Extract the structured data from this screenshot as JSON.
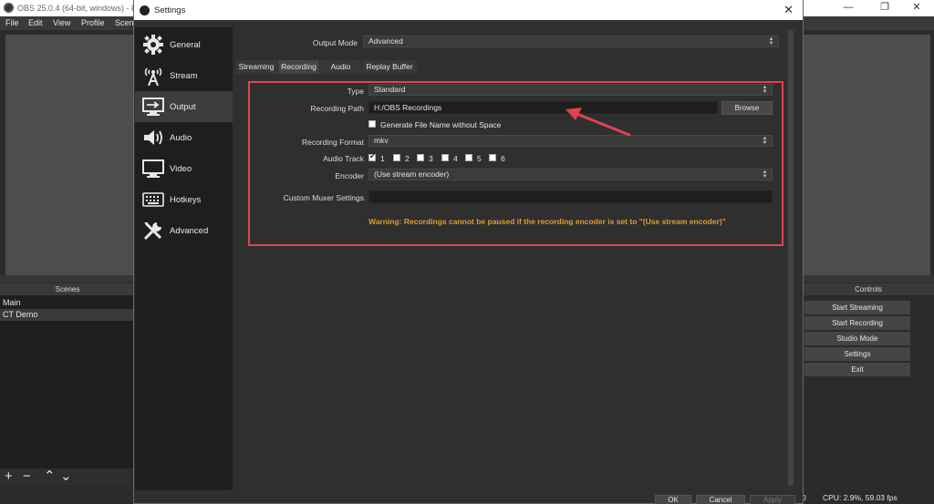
{
  "obs_window": {
    "title": "OBS 25.0.4 (64-bit, windows) - P",
    "menu": [
      "File",
      "Edit",
      "View",
      "Profile",
      "Scen"
    ],
    "scenes": {
      "header": "Scenes",
      "items": [
        "Main",
        "CT Demo"
      ],
      "selected": "CT Demo",
      "toolbar": [
        "+",
        "−",
        "⌃",
        "⌄"
      ]
    },
    "controls": {
      "header": "Controls",
      "buttons": [
        "Start Streaming",
        "Start Recording",
        "Studio Mode",
        "Settings",
        "Exit"
      ]
    },
    "status": {
      "zero": "0",
      "cpu": "CPU: 2.9%, 59.03 fps"
    }
  },
  "settings": {
    "title": "Settings",
    "nav": [
      {
        "label": "General",
        "icon": "gear-icon"
      },
      {
        "label": "Stream",
        "icon": "antenna-icon"
      },
      {
        "label": "Output",
        "icon": "monitor-arrow-icon",
        "active": true
      },
      {
        "label": "Audio",
        "icon": "speaker-icon"
      },
      {
        "label": "Video",
        "icon": "monitor-icon"
      },
      {
        "label": "Hotkeys",
        "icon": "keyboard-icon"
      },
      {
        "label": "Advanced",
        "icon": "tools-icon"
      }
    ],
    "output_mode": {
      "label": "Output Mode",
      "value": "Advanced"
    },
    "tabs": [
      "Streaming",
      "Recording",
      "Audio",
      "Replay Buffer"
    ],
    "active_tab": "Recording",
    "recording": {
      "type_label": "Type",
      "type_value": "Standard",
      "path_label": "Recording Path",
      "path_value": "H:/OBS Recordings",
      "browse_label": "Browse",
      "filename_nospace_label": "Generate File Name without Space",
      "filename_nospace_checked": false,
      "format_label": "Recording Format",
      "format_value": "mkv",
      "audio_track_label": "Audio Track",
      "audio_tracks": [
        {
          "label": "1",
          "checked": true
        },
        {
          "label": "2",
          "checked": false
        },
        {
          "label": "3",
          "checked": false
        },
        {
          "label": "4",
          "checked": false
        },
        {
          "label": "5",
          "checked": false
        },
        {
          "label": "6",
          "checked": false
        }
      ],
      "encoder_label": "Encoder",
      "encoder_value": "(Use stream encoder)",
      "muxer_label": "Custom Muxer Settings",
      "muxer_value": "",
      "warning": "Warning: Recordings cannot be paused if the recording encoder is set to \"(Use stream encoder)\""
    },
    "footer": {
      "ok": "OK",
      "cancel": "Cancel",
      "apply": "Apply"
    }
  },
  "colors": {
    "highlight": "#e0424f",
    "warning": "#e09b2d",
    "accent_arrow": "#e0424f"
  }
}
